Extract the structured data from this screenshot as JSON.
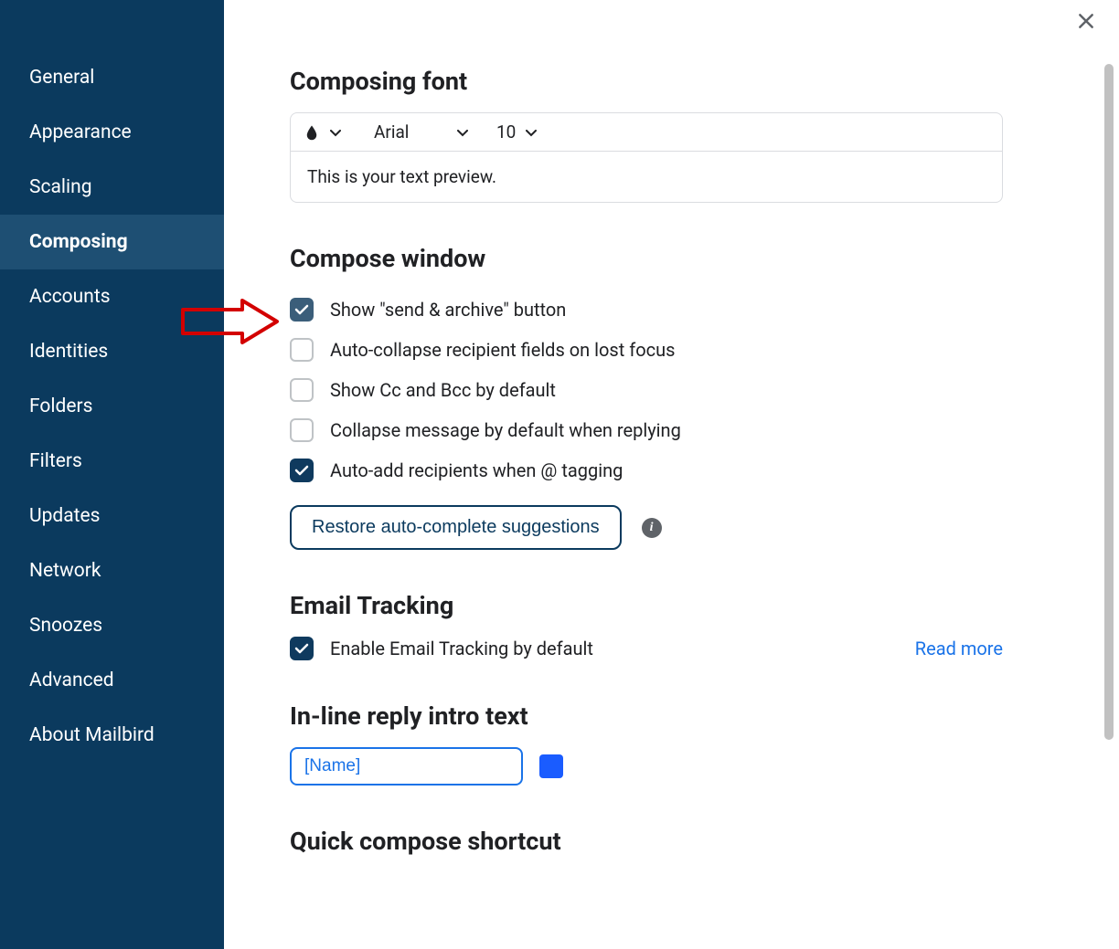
{
  "sidebar": {
    "items": [
      {
        "label": "General"
      },
      {
        "label": "Appearance"
      },
      {
        "label": "Scaling"
      },
      {
        "label": "Composing",
        "active": true
      },
      {
        "label": "Accounts"
      },
      {
        "label": "Identities"
      },
      {
        "label": "Folders"
      },
      {
        "label": "Filters"
      },
      {
        "label": "Updates"
      },
      {
        "label": "Network"
      },
      {
        "label": "Snoozes"
      },
      {
        "label": "Advanced"
      },
      {
        "label": "About Mailbird"
      }
    ]
  },
  "sections": {
    "composing_font": {
      "heading": "Composing font",
      "font_name": "Arial",
      "font_size": "10",
      "preview": "This is your text preview."
    },
    "compose_window": {
      "heading": "Compose window",
      "options": [
        {
          "label": "Show \"send & archive\" button",
          "checked": true,
          "muted": true
        },
        {
          "label": "Auto-collapse recipient fields on lost focus",
          "checked": false
        },
        {
          "label": "Show Cc and Bcc by default",
          "checked": false
        },
        {
          "label": "Collapse message by default when replying",
          "checked": false
        },
        {
          "label": "Auto-add recipients when @ tagging",
          "checked": true
        }
      ],
      "restore_label": "Restore auto-complete suggestions"
    },
    "email_tracking": {
      "heading": "Email Tracking",
      "option": {
        "label": "Enable Email Tracking by default",
        "checked": true
      },
      "read_more": "Read more"
    },
    "inline_reply": {
      "heading": "In-line reply intro text",
      "value": "[Name]"
    },
    "quick_compose": {
      "heading": "Quick compose shortcut"
    }
  }
}
